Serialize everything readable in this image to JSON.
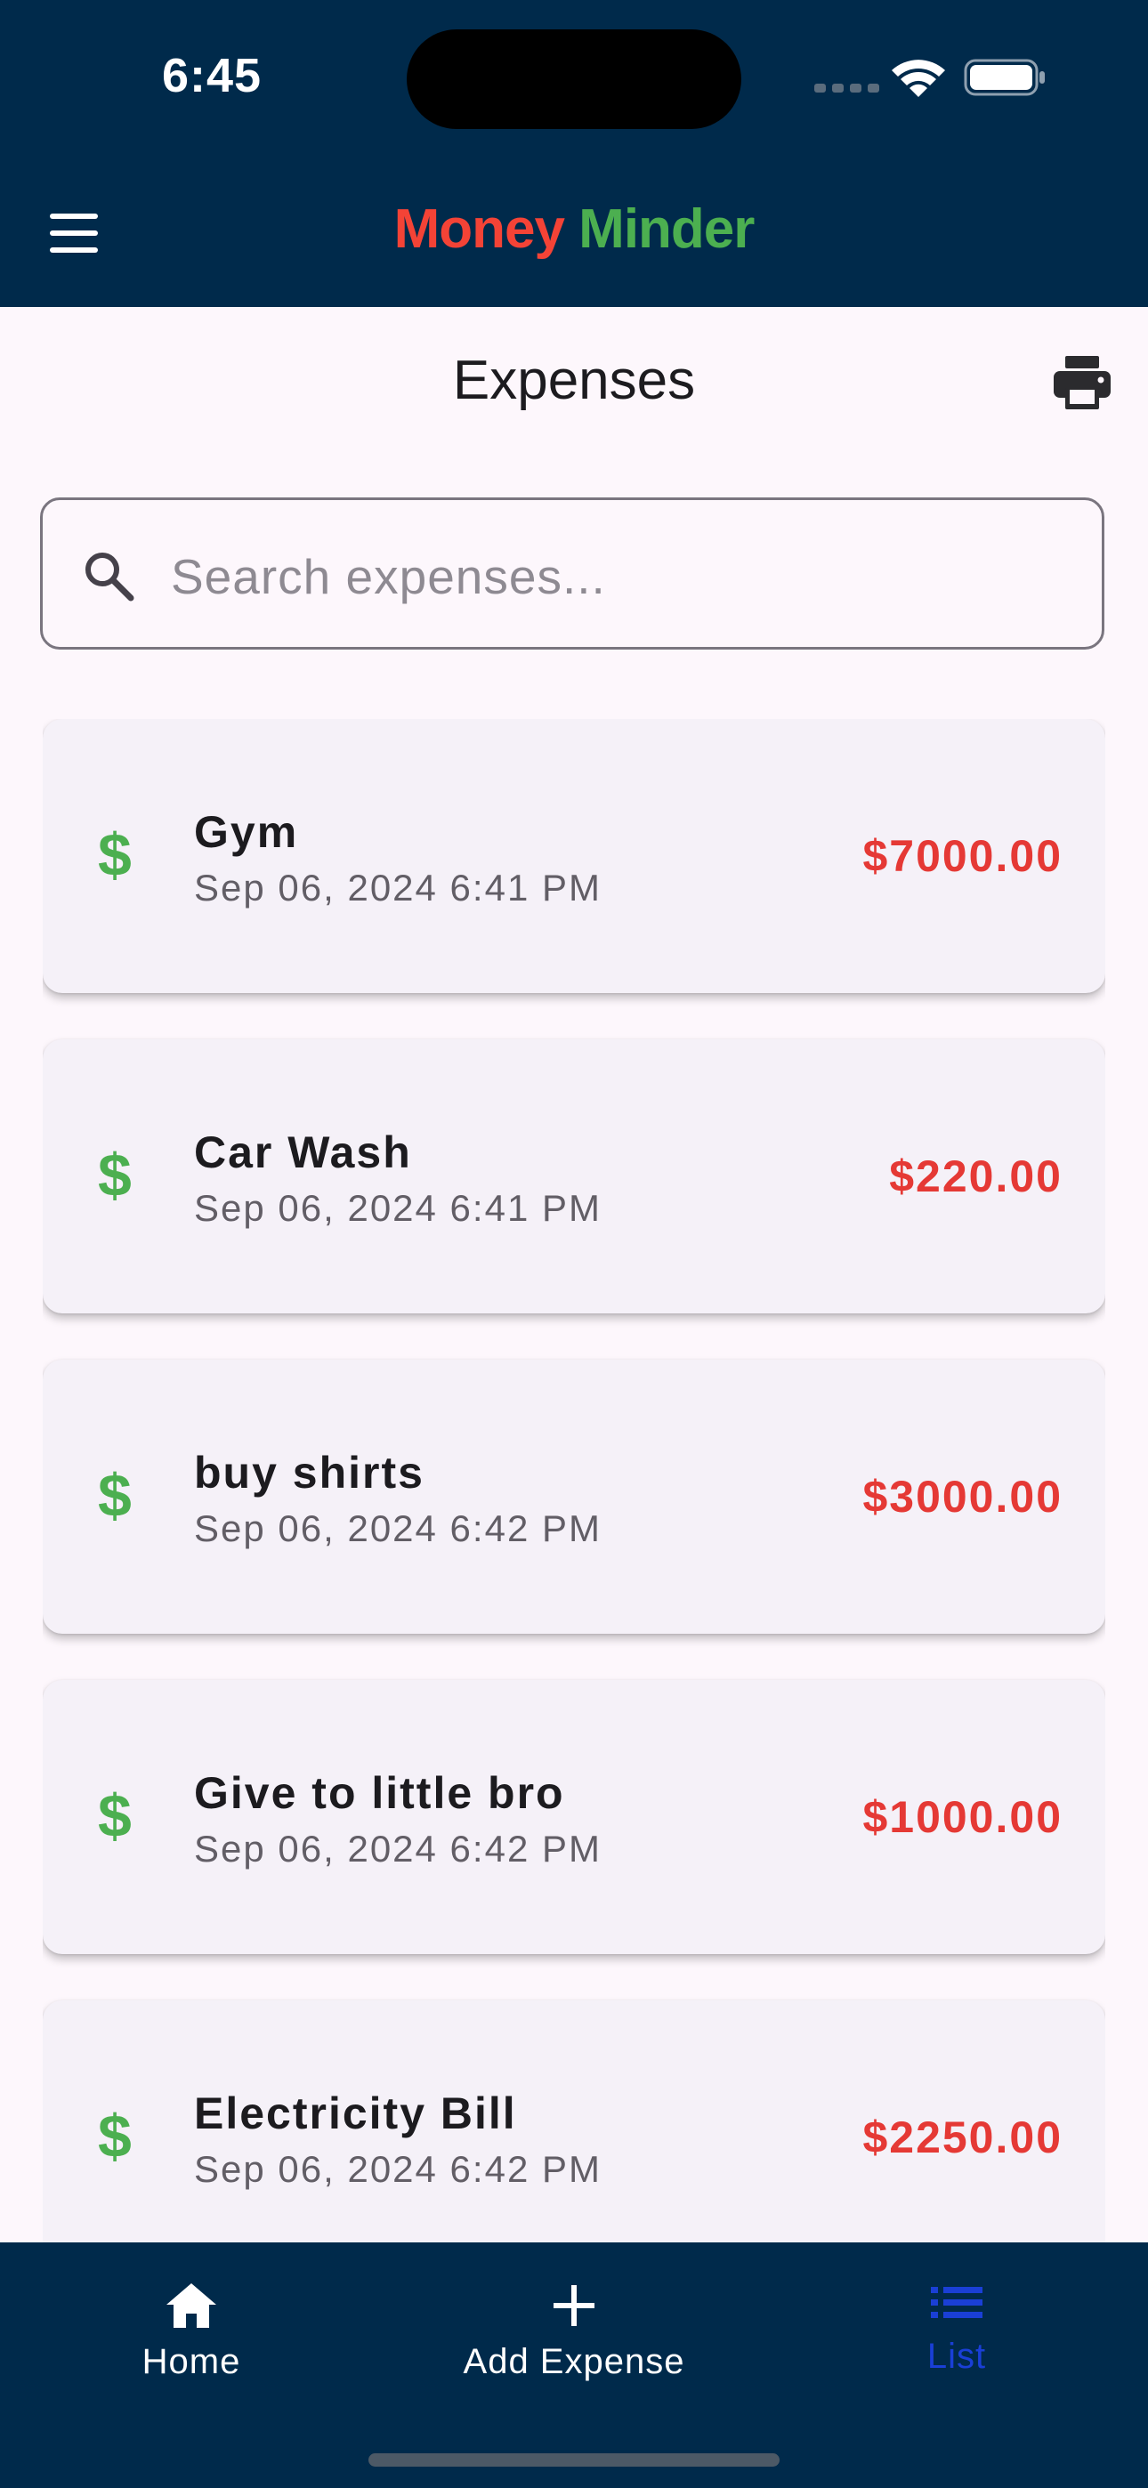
{
  "status_bar": {
    "time": "6:45"
  },
  "app_bar": {
    "title_part1": "Money",
    "title_part2": "Minder",
    "title_color_1": "#f44336",
    "title_color_2": "#4caf50",
    "background": "#002a4b",
    "menu_icon": "hamburger-menu-icon"
  },
  "page": {
    "title": "Expenses",
    "print_icon": "printer-icon"
  },
  "search": {
    "placeholder": "Search expenses...",
    "value": ""
  },
  "expenses": [
    {
      "icon": "$",
      "name": "Gym",
      "date": "Sep 06, 2024 6:41 PM",
      "amount": "$7000.00"
    },
    {
      "icon": "$",
      "name": "Car Wash",
      "date": "Sep 06, 2024 6:41 PM",
      "amount": "$220.00"
    },
    {
      "icon": "$",
      "name": "buy shirts",
      "date": "Sep 06, 2024 6:42 PM",
      "amount": "$3000.00"
    },
    {
      "icon": "$",
      "name": "Give to little bro",
      "date": "Sep 06, 2024 6:42 PM",
      "amount": "$1000.00"
    },
    {
      "icon": "$",
      "name": "Electricity Bill",
      "date": "Sep 06, 2024 6:42 PM",
      "amount": "$2250.00"
    }
  ],
  "bottom_nav": {
    "items": [
      {
        "label": "Home",
        "icon": "home-icon"
      },
      {
        "label": "Add Expense",
        "icon": "plus-icon"
      },
      {
        "label": "List",
        "icon": "list-icon",
        "active": true
      }
    ],
    "active_color": "#1a3fd6"
  }
}
